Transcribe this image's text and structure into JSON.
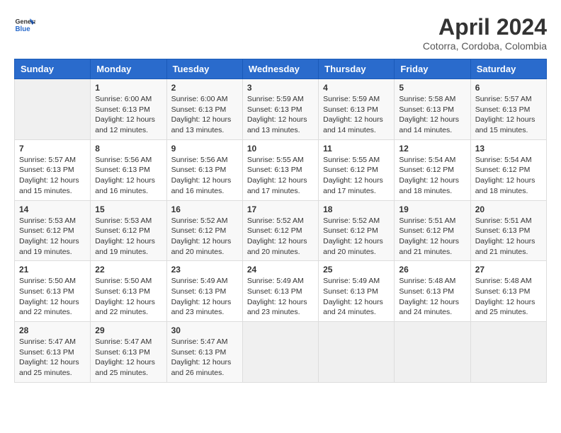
{
  "header": {
    "logo_line1": "General",
    "logo_line2": "Blue",
    "month_year": "April 2024",
    "location": "Cotorra, Cordoba, Colombia"
  },
  "days_of_week": [
    "Sunday",
    "Monday",
    "Tuesday",
    "Wednesday",
    "Thursday",
    "Friday",
    "Saturday"
  ],
  "weeks": [
    [
      {
        "day": "",
        "info": ""
      },
      {
        "day": "1",
        "info": "Sunrise: 6:00 AM\nSunset: 6:13 PM\nDaylight: 12 hours\nand 12 minutes."
      },
      {
        "day": "2",
        "info": "Sunrise: 6:00 AM\nSunset: 6:13 PM\nDaylight: 12 hours\nand 13 minutes."
      },
      {
        "day": "3",
        "info": "Sunrise: 5:59 AM\nSunset: 6:13 PM\nDaylight: 12 hours\nand 13 minutes."
      },
      {
        "day": "4",
        "info": "Sunrise: 5:59 AM\nSunset: 6:13 PM\nDaylight: 12 hours\nand 14 minutes."
      },
      {
        "day": "5",
        "info": "Sunrise: 5:58 AM\nSunset: 6:13 PM\nDaylight: 12 hours\nand 14 minutes."
      },
      {
        "day": "6",
        "info": "Sunrise: 5:57 AM\nSunset: 6:13 PM\nDaylight: 12 hours\nand 15 minutes."
      }
    ],
    [
      {
        "day": "7",
        "info": "Sunrise: 5:57 AM\nSunset: 6:13 PM\nDaylight: 12 hours\nand 15 minutes."
      },
      {
        "day": "8",
        "info": "Sunrise: 5:56 AM\nSunset: 6:13 PM\nDaylight: 12 hours\nand 16 minutes."
      },
      {
        "day": "9",
        "info": "Sunrise: 5:56 AM\nSunset: 6:13 PM\nDaylight: 12 hours\nand 16 minutes."
      },
      {
        "day": "10",
        "info": "Sunrise: 5:55 AM\nSunset: 6:13 PM\nDaylight: 12 hours\nand 17 minutes."
      },
      {
        "day": "11",
        "info": "Sunrise: 5:55 AM\nSunset: 6:12 PM\nDaylight: 12 hours\nand 17 minutes."
      },
      {
        "day": "12",
        "info": "Sunrise: 5:54 AM\nSunset: 6:12 PM\nDaylight: 12 hours\nand 18 minutes."
      },
      {
        "day": "13",
        "info": "Sunrise: 5:54 AM\nSunset: 6:12 PM\nDaylight: 12 hours\nand 18 minutes."
      }
    ],
    [
      {
        "day": "14",
        "info": "Sunrise: 5:53 AM\nSunset: 6:12 PM\nDaylight: 12 hours\nand 19 minutes."
      },
      {
        "day": "15",
        "info": "Sunrise: 5:53 AM\nSunset: 6:12 PM\nDaylight: 12 hours\nand 19 minutes."
      },
      {
        "day": "16",
        "info": "Sunrise: 5:52 AM\nSunset: 6:12 PM\nDaylight: 12 hours\nand 20 minutes."
      },
      {
        "day": "17",
        "info": "Sunrise: 5:52 AM\nSunset: 6:12 PM\nDaylight: 12 hours\nand 20 minutes."
      },
      {
        "day": "18",
        "info": "Sunrise: 5:52 AM\nSunset: 6:12 PM\nDaylight: 12 hours\nand 20 minutes."
      },
      {
        "day": "19",
        "info": "Sunrise: 5:51 AM\nSunset: 6:12 PM\nDaylight: 12 hours\nand 21 minutes."
      },
      {
        "day": "20",
        "info": "Sunrise: 5:51 AM\nSunset: 6:13 PM\nDaylight: 12 hours\nand 21 minutes."
      }
    ],
    [
      {
        "day": "21",
        "info": "Sunrise: 5:50 AM\nSunset: 6:13 PM\nDaylight: 12 hours\nand 22 minutes."
      },
      {
        "day": "22",
        "info": "Sunrise: 5:50 AM\nSunset: 6:13 PM\nDaylight: 12 hours\nand 22 minutes."
      },
      {
        "day": "23",
        "info": "Sunrise: 5:49 AM\nSunset: 6:13 PM\nDaylight: 12 hours\nand 23 minutes."
      },
      {
        "day": "24",
        "info": "Sunrise: 5:49 AM\nSunset: 6:13 PM\nDaylight: 12 hours\nand 23 minutes."
      },
      {
        "day": "25",
        "info": "Sunrise: 5:49 AM\nSunset: 6:13 PM\nDaylight: 12 hours\nand 24 minutes."
      },
      {
        "day": "26",
        "info": "Sunrise: 5:48 AM\nSunset: 6:13 PM\nDaylight: 12 hours\nand 24 minutes."
      },
      {
        "day": "27",
        "info": "Sunrise: 5:48 AM\nSunset: 6:13 PM\nDaylight: 12 hours\nand 25 minutes."
      }
    ],
    [
      {
        "day": "28",
        "info": "Sunrise: 5:47 AM\nSunset: 6:13 PM\nDaylight: 12 hours\nand 25 minutes."
      },
      {
        "day": "29",
        "info": "Sunrise: 5:47 AM\nSunset: 6:13 PM\nDaylight: 12 hours\nand 25 minutes."
      },
      {
        "day": "30",
        "info": "Sunrise: 5:47 AM\nSunset: 6:13 PM\nDaylight: 12 hours\nand 26 minutes."
      },
      {
        "day": "",
        "info": ""
      },
      {
        "day": "",
        "info": ""
      },
      {
        "day": "",
        "info": ""
      },
      {
        "day": "",
        "info": ""
      }
    ]
  ]
}
